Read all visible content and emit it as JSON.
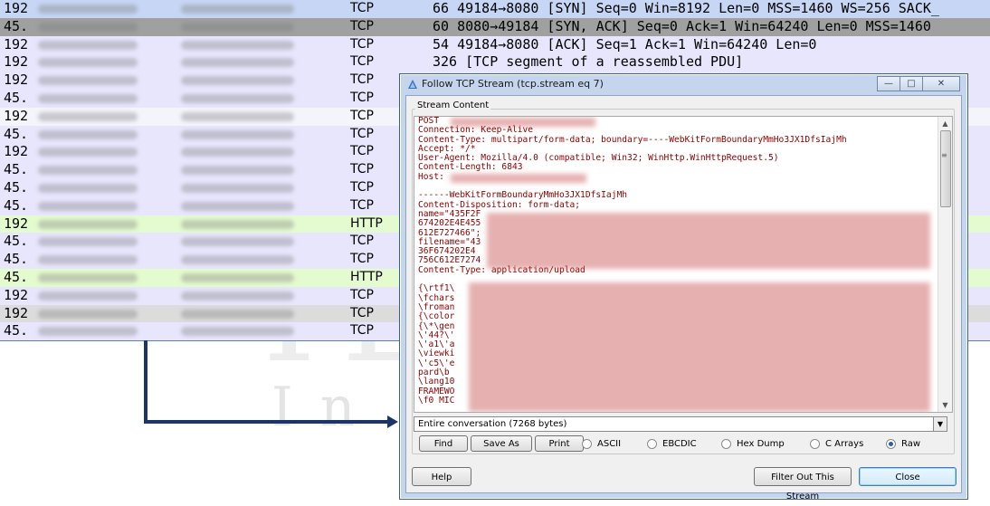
{
  "packet_rows": [
    {
      "no": "192",
      "proto": "TCP",
      "info": "66 49184→8080 [SYN] Seq=0 Win=8192 Len=0 MSS=1460 WS=256 SACK_",
      "style": "r-selblue"
    },
    {
      "no": "45.",
      "proto": "TCP",
      "info": "60 8080→49184 [SYN, ACK] Seq=0 Ack=1 Win=64240 Len=0 MSS=1460",
      "style": "r-dark"
    },
    {
      "no": "192",
      "proto": "TCP",
      "info": "54 49184→8080 [ACK] Seq=1 Ack=1 Win=64240 Len=0",
      "style": "r-lav"
    },
    {
      "no": "192",
      "proto": "TCP",
      "info": "326 [TCP segment of a reassembled PDU]",
      "style": "r-lav"
    },
    {
      "no": "192",
      "proto": "TCP",
      "info": "",
      "style": "r-lav"
    },
    {
      "no": "45.",
      "proto": "TCP",
      "info": "",
      "style": "r-lav"
    },
    {
      "no": "192",
      "proto": "TCP",
      "info": "",
      "style": "r-white"
    },
    {
      "no": "45.",
      "proto": "TCP",
      "info": "",
      "style": "r-lav"
    },
    {
      "no": "192",
      "proto": "TCP",
      "info": "",
      "style": "r-lav"
    },
    {
      "no": "45.",
      "proto": "TCP",
      "info": "",
      "style": "r-lav"
    },
    {
      "no": "45.",
      "proto": "TCP",
      "info": "",
      "style": "r-lav"
    },
    {
      "no": "45.",
      "proto": "TCP",
      "info": "",
      "style": "r-lav"
    },
    {
      "no": "192",
      "proto": "HTTP",
      "info": "",
      "style": "r-green"
    },
    {
      "no": "45.",
      "proto": "TCP",
      "info": "",
      "style": "r-lav"
    },
    {
      "no": "45.",
      "proto": "TCP",
      "info": "",
      "style": "r-lav"
    },
    {
      "no": "45.",
      "proto": "HTTP",
      "info": "",
      "style": "r-green"
    },
    {
      "no": "192",
      "proto": "TCP",
      "info": "",
      "style": "r-lav"
    },
    {
      "no": "192",
      "proto": "TCP",
      "info": "",
      "style": "r-grey"
    },
    {
      "no": "45.",
      "proto": "TCP",
      "info": "",
      "style": "r-lav"
    }
  ],
  "watermark": {
    "line1": "IL",
    "line2": "In"
  },
  "dialog": {
    "title": "Follow TCP Stream (tcp.stream eq 7)",
    "group_label": "Stream Content",
    "stream_text": "POST \nConnection: Keep-Alive\nContent-Type: multipart/form-data; boundary=----WebKitFormBoundaryMmHo3JX1DfsIajMh\nAccept: */*\nUser-Agent: Mozilla/4.0 (compatible; Win32; WinHttp.WinHttpRequest.5)\nContent-Length: 6843\nHost: \n\n------WebKitFormBoundaryMmHo3JX1DfsIajMh\nContent-Disposition: form-data;\nname=\"435F2F\n674202E4E455\n612E727466\";\nfilename=\"43\n36F674202E4\n756C612E7274\nContent-Type: application/upload\n\n{\\rtf1\\\n\\fchars\n\\froman\n{\\color\n{\\*\\gen\n\\'44?\\'\n\\'a1\\'a\n\\viewki\n\\'c5\\'e\npard\\b\n\\lang10\nFRAMEWO\n\\f0 MIC",
    "conversation": "Entire conversation (7268 bytes)",
    "buttons": {
      "find": "Find",
      "save_as": "Save As",
      "print": "Print",
      "help": "Help",
      "filter": "Filter Out This Stream",
      "close": "Close"
    },
    "radios": [
      {
        "label": "ASCII",
        "selected": false
      },
      {
        "label": "EBCDIC",
        "selected": false
      },
      {
        "label": "Hex Dump",
        "selected": false
      },
      {
        "label": "C Arrays",
        "selected": false
      },
      {
        "label": "Raw",
        "selected": true
      }
    ],
    "window_buttons": {
      "minimize": "—",
      "maximize": "□",
      "close": "✕"
    }
  }
}
